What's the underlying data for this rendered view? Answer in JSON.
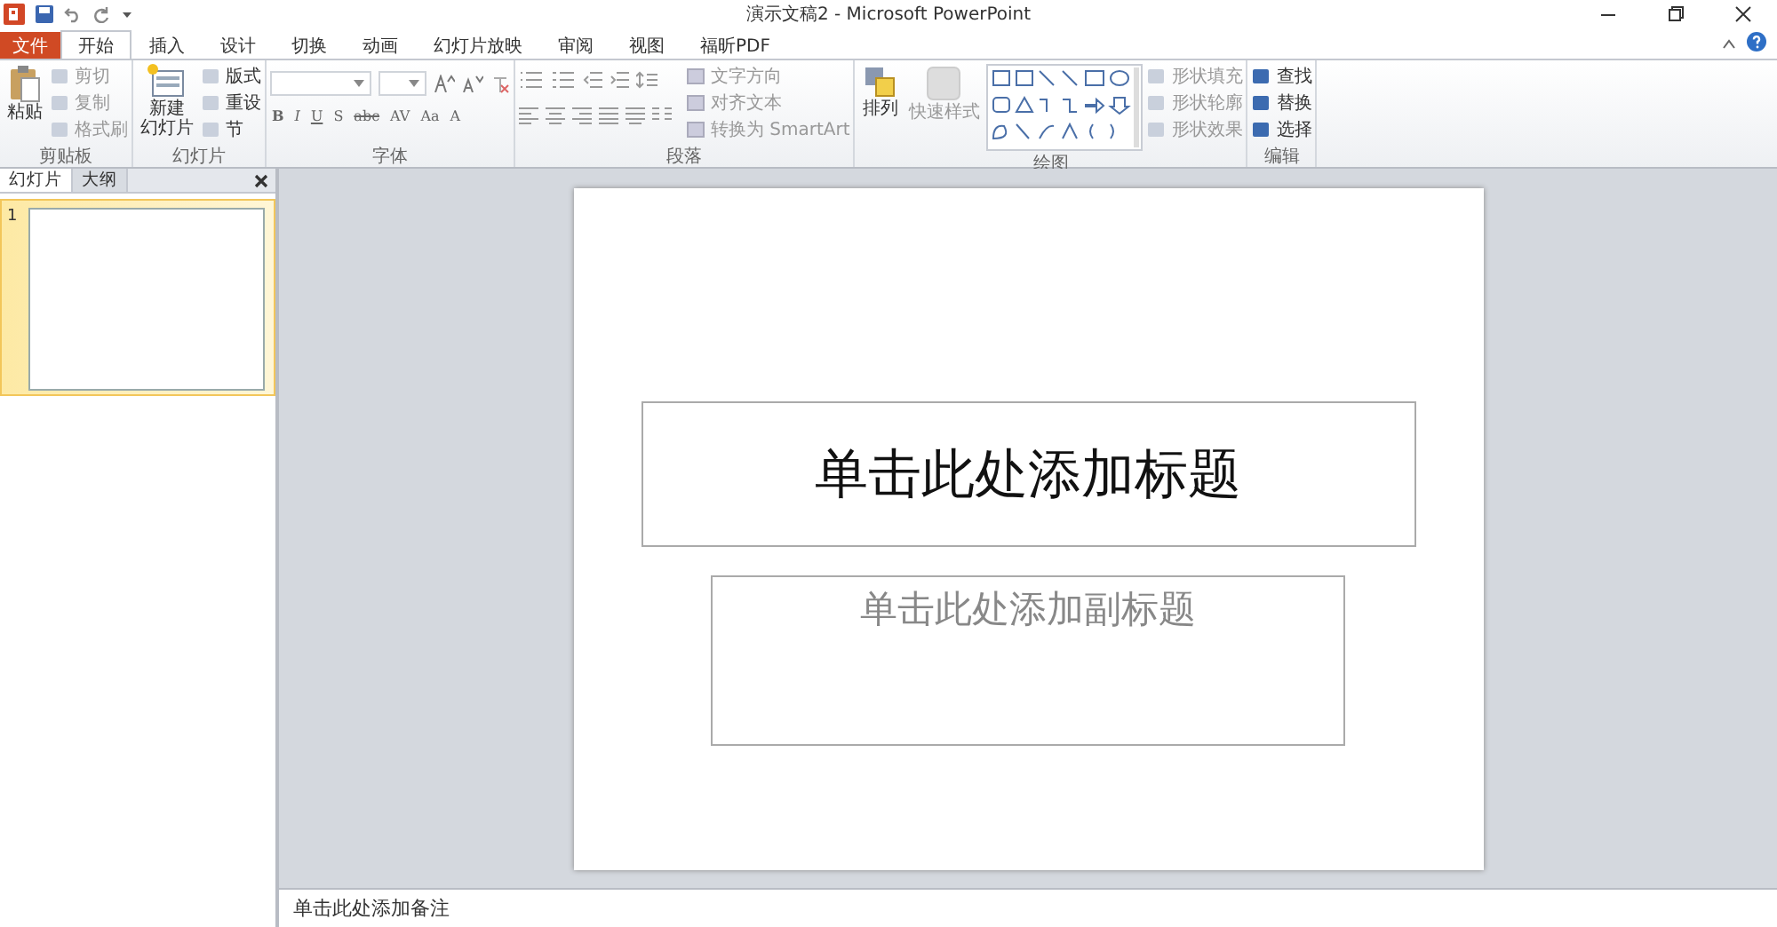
{
  "window": {
    "title": "演示文稿2 - Microsoft PowerPoint"
  },
  "menu_tabs": [
    {
      "label": "文件",
      "kind": "file",
      "selected": false
    },
    {
      "label": "开始",
      "kind": "tab",
      "selected": true
    },
    {
      "label": "插入",
      "kind": "tab",
      "selected": false
    },
    {
      "label": "设计",
      "kind": "tab",
      "selected": false
    },
    {
      "label": "切换",
      "kind": "tab",
      "selected": false
    },
    {
      "label": "动画",
      "kind": "tab",
      "selected": false
    },
    {
      "label": "幻灯片放映",
      "kind": "tab",
      "selected": false
    },
    {
      "label": "审阅",
      "kind": "tab",
      "selected": false
    },
    {
      "label": "视图",
      "kind": "tab",
      "selected": false
    },
    {
      "label": "福昕PDF",
      "kind": "tab",
      "selected": false
    }
  ],
  "ribbon": [
    {
      "kind": "clipboard",
      "label": "剪贴板",
      "large": [
        {
          "lines": [
            "粘贴"
          ],
          "disabled": false
        }
      ],
      "items": [
        {
          "label": "剪切",
          "disabled": true
        },
        {
          "label": "复制",
          "disabled": true
        },
        {
          "label": "格式刷",
          "disabled": true
        }
      ]
    },
    {
      "kind": "slides",
      "label": "幻灯片",
      "large": [
        {
          "lines": [
            "新建",
            "幻灯片"
          ],
          "disabled": false
        }
      ],
      "items": [
        {
          "label": "版式",
          "disabled": false
        },
        {
          "label": "重设",
          "disabled": false
        },
        {
          "label": "节",
          "disabled": false
        }
      ]
    },
    {
      "kind": "font",
      "label": "字体",
      "format_buttons": [
        "B",
        "I",
        "U",
        "S",
        "abc",
        "AV",
        "Aa",
        "A"
      ]
    },
    {
      "kind": "paragraph",
      "label": "段落",
      "items": [
        {
          "label": "文字方向",
          "disabled": true
        },
        {
          "label": "对齐文本",
          "disabled": true
        },
        {
          "label": "转换为 SmartArt",
          "disabled": true
        }
      ]
    },
    {
      "kind": "drawing",
      "label": "绘图",
      "large": [
        {
          "lines": [
            "排列"
          ],
          "disabled": false
        },
        {
          "lines": [
            "快速样式"
          ],
          "disabled": true
        }
      ],
      "items": [
        {
          "label": "形状填充",
          "disabled": true
        },
        {
          "label": "形状轮廓",
          "disabled": true
        },
        {
          "label": "形状效果",
          "disabled": true
        }
      ]
    },
    {
      "kind": "editing",
      "label": "编辑",
      "items": [
        {
          "label": "查找",
          "disabled": false
        },
        {
          "label": "替换",
          "disabled": false
        },
        {
          "label": "选择",
          "disabled": false
        }
      ]
    }
  ],
  "pane_tabs": [
    {
      "label": "幻灯片",
      "selected": true
    },
    {
      "label": "大纲",
      "selected": false
    }
  ],
  "slides": [
    {
      "number": "1",
      "selected": true
    }
  ],
  "slide": {
    "title_placeholder": "单击此处添加标题",
    "subtitle_placeholder": "单击此处添加副标题"
  },
  "notes": {
    "placeholder": "单击此处添加备注"
  }
}
